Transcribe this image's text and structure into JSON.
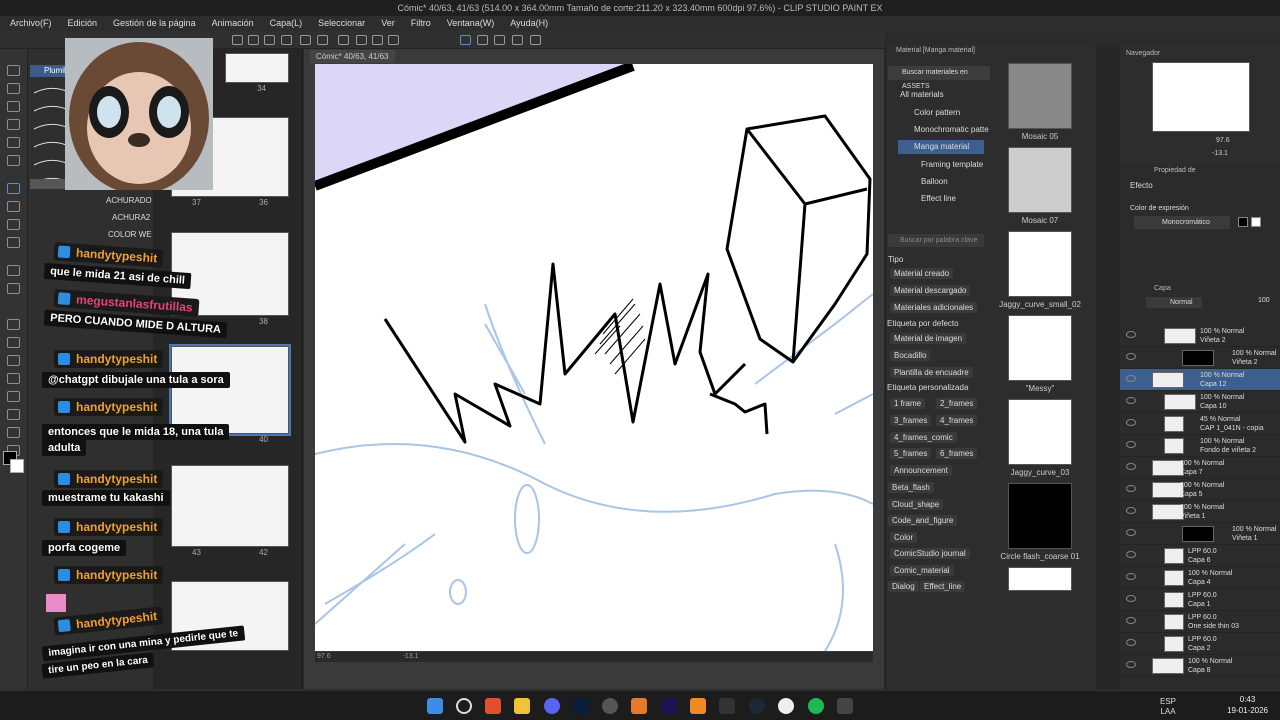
{
  "window_title": "Cómic* 40/63, 41/63 (514.00 x 364.00mm Tamaño de corte:211.20 x 323.40mm 600dpi 97.6%) - CLIP STUDIO PAINT EX",
  "menu": [
    "Archivo(F)",
    "Edición",
    "Gestión de la página",
    "Animación",
    "Capa(L)",
    "Seleccionar",
    "Ver",
    "Filtro",
    "Ventana(W)",
    "Ayuda(H)"
  ],
  "doc_tab": "Cómic* 40/63, 41/63",
  "subtool_tab": "Plumill",
  "subtools": {
    "achurado": "ACHURADO",
    "achura2": "ACHURA2",
    "color_we": "COLOR WE"
  },
  "pages": [
    {
      "n": "34"
    },
    {
      "n": "37"
    },
    {
      "n": "36"
    },
    {
      "n": "38"
    },
    {
      "n": "40"
    },
    {
      "n": "43"
    },
    {
      "n": "42"
    }
  ],
  "canvas_status": {
    "zoom": "97.6",
    "angle": "-13.1"
  },
  "material": {
    "panel_title": "Material [Manga material]",
    "search_assets": "Buscar materiales en ASSETS",
    "tree": [
      "All materials",
      "Color pattern",
      "Monochromatic patte",
      "Manga material",
      "Framing template",
      "Balloon",
      "Effect line"
    ],
    "keyword_placeholder": "Buscar por palabra clave",
    "tipo_label": "Tipo",
    "tipo": [
      "Material creado",
      "Material descargado",
      "Materiales adicionales"
    ],
    "default_label": "Etiqueta por defecto",
    "default_tags": [
      "Material de imagen",
      "Bocadillo",
      "Plantilla de encuadre"
    ],
    "custom_label": "Etiqueta personalizada",
    "custom_tags": [
      "1 frame",
      "2_frames",
      "3_frames",
      "4_frames",
      "4_frames_comic",
      "5_frames",
      "6_frames",
      "Announcement",
      "Beta_flash",
      "Cloud_shape",
      "Code_and_figure",
      "Color",
      "ComicStudio journal",
      "Comic_material",
      "Dialog",
      "Effect_line"
    ],
    "items": [
      "Mosaic 05",
      "Mosaic 07",
      "Jaggy_curve_small_02",
      "\"Messy\"",
      "Jaggy_curve_03",
      "Circle flash_coarse 01"
    ]
  },
  "navigator": {
    "title": "Navegador",
    "zoom": "97.6",
    "angle": "-13.1"
  },
  "props": {
    "title": "Propiedad de",
    "effect": "Efecto",
    "expr_label": "Color de expresión",
    "expr_value": "Monocromático"
  },
  "layers": {
    "title": "Capa",
    "blend": "Normal",
    "opacity": "100",
    "items": [
      {
        "line1": "100 % Normal",
        "line2": "Viñeta 2"
      },
      {
        "line1": "100 % Normal",
        "line2": "Viñeta 2"
      },
      {
        "line1": "100 % Normal",
        "line2": "Capa 12"
      },
      {
        "line1": "100 % Normal",
        "line2": "Capa 10"
      },
      {
        "line1": "45 % Normal",
        "line2": "CAP 1_041N - copia"
      },
      {
        "line1": "100 % Normal",
        "line2": "Fondo de viñeta 2"
      },
      {
        "line1": "100 % Normal",
        "line2": "Capa 7"
      },
      {
        "line1": "100 % Normal",
        "line2": "Capa 5"
      },
      {
        "line1": "100 % Normal",
        "line2": "Viñeta 1"
      },
      {
        "line1": "100 % Normal",
        "line2": "Viñeta 1"
      },
      {
        "line1": "LPP 60.0",
        "line2": "Capa 6"
      },
      {
        "line1": "100 % Normal",
        "line2": "Capa 4"
      },
      {
        "line1": "LPP 60.0",
        "line2": "Capa 1"
      },
      {
        "line1": "LPP 60.0",
        "line2": "One side thin 03"
      },
      {
        "line1": "LPP 60.0",
        "line2": "Capa 2"
      },
      {
        "line1": "100 % Normal",
        "line2": "Capa 8"
      }
    ]
  },
  "chat": [
    {
      "user": "handytypeshit",
      "msg": "que le mida 21 asi de chill"
    },
    {
      "user": "megustanlasfrutillas",
      "msg": "PERO CUANDO MIDE D ALTURA"
    },
    {
      "user": "handytypeshit",
      "msg": "@chatgpt dibujale una tula a sora"
    },
    {
      "user": "handytypeshit",
      "msg": "entonces que le mida 18, una tula"
    },
    {
      "user": "",
      "msg": "adulta"
    },
    {
      "user": "handytypeshit",
      "msg": "muestrame tu kakashi"
    },
    {
      "user": "handytypeshit",
      "msg": "porfa cogeme"
    },
    {
      "user": "handytypeshit",
      "msg": ""
    },
    {
      "user": "handytypeshit",
      "msg": "imagina ir con una mina y pedirle que te"
    },
    {
      "user": "",
      "msg": "tire un peo en la cara"
    }
  ],
  "taskbar": {
    "lang1": "ESP",
    "lang2": "LAA",
    "time": "0:43",
    "date": "19-01-2026"
  },
  "colors": {
    "accent": "#2d6fc0",
    "canvas_tint": "#dcd6f7",
    "sketch_blue": "#a8c4e6",
    "chat_user": "#f0a030"
  }
}
